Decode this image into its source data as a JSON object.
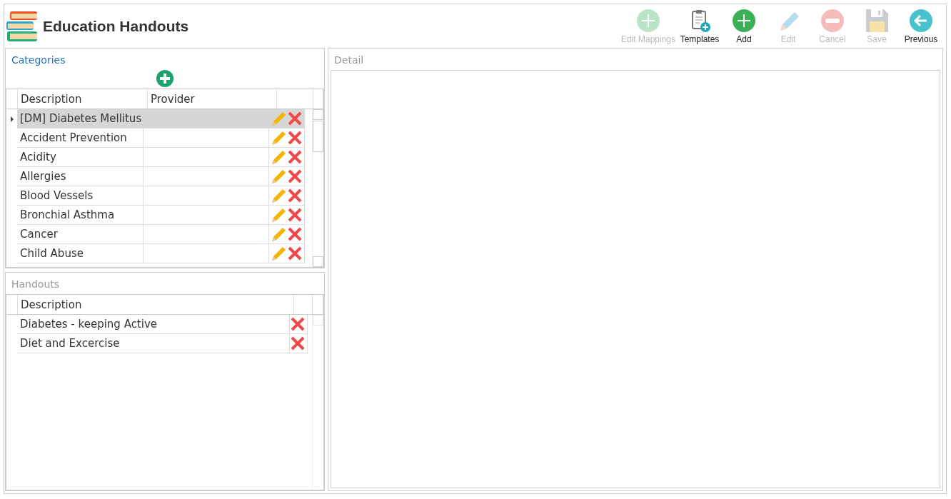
{
  "header": {
    "title": "Education Handouts"
  },
  "toolbar": [
    {
      "kind": "add-light",
      "label": "Edit Mappings",
      "disabled": true
    },
    {
      "kind": "template",
      "label": "Templates",
      "disabled": false
    },
    {
      "kind": "add",
      "label": "Add",
      "disabled": false
    },
    {
      "kind": "edit",
      "label": "Edit",
      "disabled": true
    },
    {
      "kind": "cancel",
      "label": "Cancel",
      "disabled": true
    },
    {
      "kind": "save",
      "label": "Save",
      "disabled": true
    },
    {
      "kind": "back",
      "label": "Previous",
      "disabled": false
    }
  ],
  "categories": {
    "title": "Categories",
    "active": true,
    "columns": [
      "Description",
      "Provider"
    ],
    "rows": [
      {
        "description": "[DM] Diabetes Mellitus",
        "selected": true
      },
      {
        "description": "Accident Prevention",
        "selected": false
      },
      {
        "description": "Acidity",
        "selected": false
      },
      {
        "description": "Allergies",
        "selected": false
      },
      {
        "description": "Blood Vessels",
        "selected": false
      },
      {
        "description": "Bronchial Asthma",
        "selected": false
      },
      {
        "description": "Cancer",
        "selected": false
      },
      {
        "description": "Child Abuse",
        "selected": false
      }
    ]
  },
  "handouts": {
    "title": "Handouts",
    "active": false,
    "columns": [
      "Description"
    ],
    "rows": [
      {
        "description": "Diabetes - keeping Active"
      },
      {
        "description": "Diet and Excercise"
      }
    ]
  },
  "detail": {
    "title": "Detail",
    "active": false
  }
}
